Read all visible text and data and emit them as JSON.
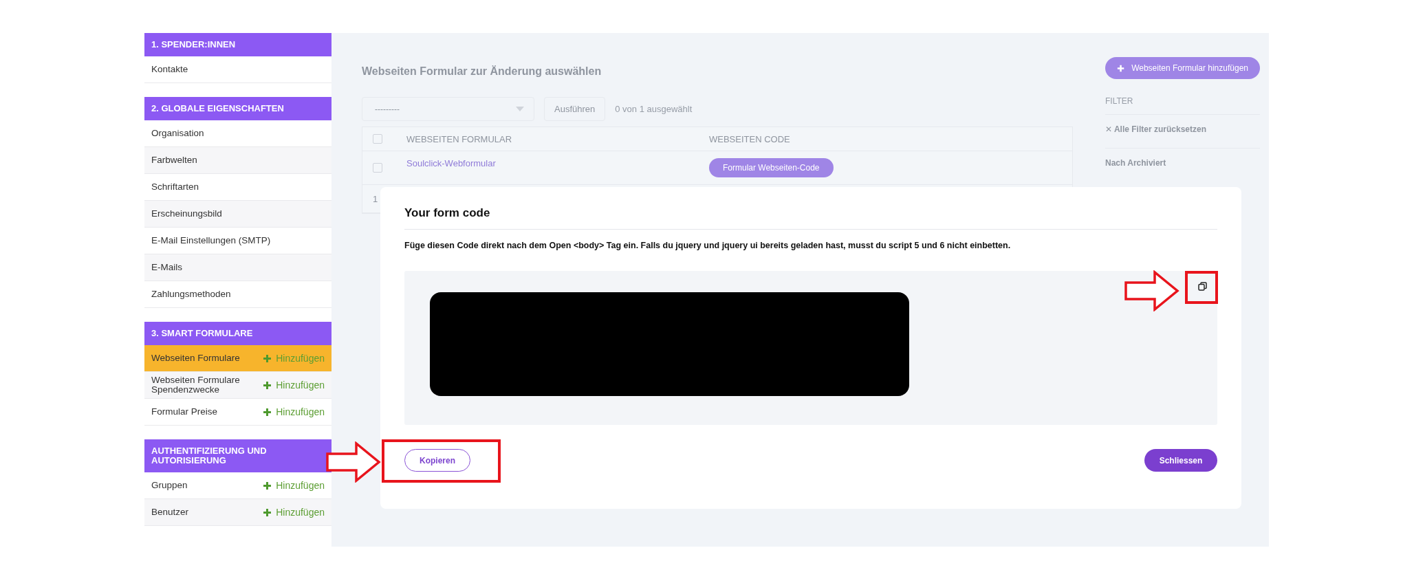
{
  "sidebar": {
    "sections": [
      {
        "title": "1. SPENDER:INNEN",
        "items": [
          {
            "label": "Kontakte",
            "selected": false
          }
        ]
      },
      {
        "title": "2. GLOBALE EIGENSCHAFTEN",
        "items": [
          {
            "label": "Organisation",
            "selected": false
          },
          {
            "label": "Farbwelten",
            "selected": false
          },
          {
            "label": "Schriftarten",
            "selected": false
          },
          {
            "label": "Erscheinungsbild",
            "selected": false
          },
          {
            "label": "E-Mail Einstellungen (SMTP)",
            "selected": false
          },
          {
            "label": "E-Mails",
            "selected": false
          },
          {
            "label": "Zahlungsmethoden",
            "selected": false
          }
        ]
      },
      {
        "title": "3. SMART FORMULARE",
        "items": [
          {
            "label": "Webseiten Formulare",
            "selected": true,
            "add_label": "Hinzufügen"
          },
          {
            "label": "Webseiten Formulare Spendenzwecke",
            "selected": false,
            "add_label": "Hinzufügen"
          },
          {
            "label": "Formular Preise",
            "selected": false,
            "add_label": "Hinzufügen"
          }
        ]
      },
      {
        "title": "AUTHENTIFIZIERUNG UND AUTORISIERUNG",
        "items": [
          {
            "label": "Gruppen",
            "selected": false,
            "add_label": "Hinzufügen"
          },
          {
            "label": "Benutzer",
            "selected": false,
            "add_label": "Hinzufügen"
          }
        ]
      }
    ]
  },
  "background_page": {
    "title": "Webseiten Formular zur Änderung auswählen",
    "action_select": {
      "value": "---------"
    },
    "run_button": "Ausführen",
    "selection_count": "0 von 1 ausgewählt",
    "table": {
      "columns": [
        "WEBSEITEN FORMULAR",
        "WEBSEITEN CODE"
      ],
      "all_checked": false,
      "rows": [
        {
          "name": "Soulclick-Webformular",
          "code_button": "Formular Webseiten-Code",
          "checked": false
        }
      ],
      "footer": "1"
    },
    "add_button": "Webseiten Formular hinzufügen",
    "filter": {
      "title": "FILTER",
      "reset": "✕ Alle Filter zurücksetzen",
      "groups": [
        "Nach Archiviert"
      ]
    }
  },
  "modal": {
    "title": "Your form code",
    "description": "Füge diesen Code direkt nach dem Open <body> Tag ein. Falls du jquery und jquery ui bereits geladen hast, musst du script 5 und 6 nicht einbetten.",
    "code_redacted": true,
    "copy_icon_highlighted": true,
    "buttons": [
      {
        "label": "Kopieren",
        "kind": "outline",
        "highlighted": true
      },
      {
        "label": "Schliessen",
        "kind": "filled",
        "highlighted": false
      }
    ]
  }
}
